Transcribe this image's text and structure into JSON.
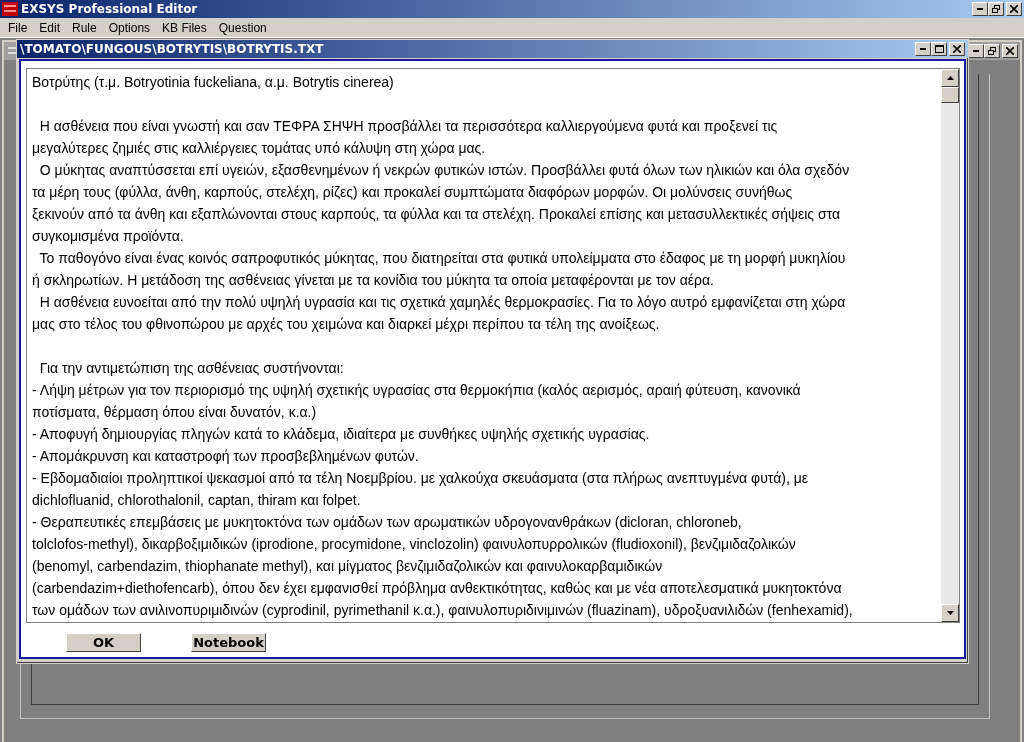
{
  "window": {
    "title": "EXSYS Professional Editor"
  },
  "menu": [
    "File",
    "Edit",
    "Rule",
    "Options",
    "KB Files",
    "Question"
  ],
  "dialog": {
    "title": "\\TOMATO\\FUNGOUS\\BOTRYTIS\\BOTRYTIS.TXT",
    "sections": [
      [
        "Βοτρύτης (τ.μ. Botryotinia fuckeliana, α.μ. Botrytis cinerea)"
      ],
      [
        "  Η ασθένεια που είναι γνωστή και σαν ΤΕΦΡΑ ΣΗΨΗ προσβάλλει τα περισσότερα καλλιεργούμενα φυτά και προξενεί τις",
        "μεγαλύτερες ζημιές στις καλλιέργειες τομάτας υπό κάλυψη στη χώρα μας.",
        "  Ο μύκητας αναπτύσσεται επί υγειών, εξασθενημένων ή νεκρών φυτικών ιστών. Προσβάλλει φυτά όλων των ηλικιών και όλα σχεδόν",
        "τα μέρη τους (φύλλα, άνθη, καρπούς, στελέχη, ρίζες) και προκαλεί συμπτώματα διαφόρων μορφών. Οι μολύνσεις συνήθως",
        "ξεκινούν από τα άνθη και εξαπλώνονται στους καρπούς, τα φύλλα και τα στελέχη. Προκαλεί επίσης και μετασυλλεκτικές σήψεις στα",
        "συγκομισμένα προϊόντα.",
        "  Το παθογόνο είναι ένας κοινός σαπροφυτικός μύκητας, που διατηρείται στα φυτικά υπολείμματα στο έδαφος με τη μορφή μυκηλίου",
        "ή σκληρωτίων. Η μετάδοση της ασθένειας γίνεται με τα κονίδια του μύκητα τα οποία μεταφέρονται με τον αέρα.",
        "  Η ασθένεια ευνοείται από την πολύ υψηλή υγρασία και τις σχετικά χαμηλές θερμοκρασίες. Για το λόγο αυτρό εμφανίζεται στη χώρα",
        "μας στο τέλος του φθινοπώρου με αρχές του χειμώνα και διαρκεί μέχρι περίπου τα τέλη της ανοίξεως."
      ],
      [
        "  Για την αντιμετώπιση της ασθένειας συστήνονται:",
        "- Λήψη μέτρων για τον περιορισμό της υψηλή σχετικής υγρασίας στα θερμοκήπια (καλός αερισμός, αραιή φύτευση, κανονικά",
        "ποτίσματα, θέρμαση όπου είναι δυνατόν, κ.α.)",
        "- Αποφυγή δημιουργίας πληγών κατά το κλάδεμα, ιδιαίτερα με συνθήκες υψηλής σχετικής υγρασίας.",
        "- Απομάκρυνση και καταστροφή των προσβεβλημένων φυτών.",
        "- Εβδομαδιαίοι προληπτικοί ψεκασμοί από τα τέλη Νοεμβρίου. με χαλκούχα σκευάσματα (στα πλήρως ανεπτυγμένα φυτά), με",
        "dichlofluanid, chlorothalonil, captan, thiram και folpet.",
        "- Θεραπευτικές επεμβάσεις με μυκητοκτόνα των ομάδων των αρωματικών υδρογονανθράκων (dicloran, chloroneb,",
        "tolclofos-methyl), δικαρβοξιμιδικών (iprodione, procymidone, vinclozolin) φαινυλοπυρρολικών (fludioxonil), βενζιμιδαζολικών",
        "(benomyl, carbendazim, thiophanate methyl), και μίγματος βενζιμιδαζολικών και φαινυλοκαρβαμιδικών",
        "(carbendazim+diethofencarb), όπου δεν έχει εμφανισθεί πρόβλημα ανθεκτικότητας, καθώς και με νέα αποτελεσματικά μυκητοκτόνα",
        "των ομάδων των ανιλινοπυριμιδινών (cyprodinil, pyrimethanil κ.α.), φαινυλοπυριδινιμινών (fluazinam), υδροξυανιλιδών (fenhexamid),"
      ]
    ],
    "buttons": [
      "OK",
      "Notebook"
    ]
  }
}
